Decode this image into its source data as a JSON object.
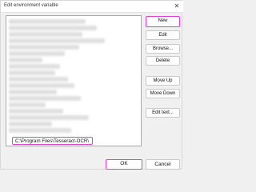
{
  "window": {
    "title": "Edit environment variable",
    "close_glyph": "✕"
  },
  "list": {
    "selected_value": "C:\\Program Files\\Tesseract-OCR\\"
  },
  "buttons": {
    "new": "New",
    "edit": "Edit",
    "browse": "Browse...",
    "delete": "Delete",
    "move_up": "Move Up",
    "move_down": "Move Down",
    "edit_text": "Edit text..."
  },
  "footer": {
    "ok": "OK",
    "cancel": "Cancel"
  },
  "colors": {
    "highlight": "#e33fd6",
    "background": "#f0f0f0"
  }
}
